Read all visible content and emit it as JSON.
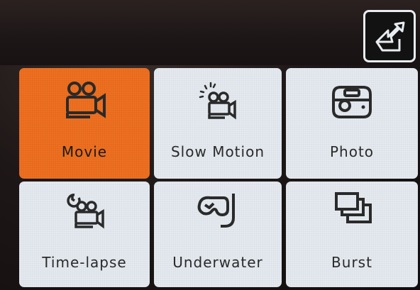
{
  "screen_title": "",
  "back_button": {
    "icon": "return-arrow-icon"
  },
  "modes": [
    {
      "label": "Movie",
      "icon": "movie-camera-icon",
      "selected": true
    },
    {
      "label": "Slow Motion",
      "icon": "slow-motion-camera-icon",
      "selected": false
    },
    {
      "label": "Photo",
      "icon": "photo-camera-icon",
      "selected": false
    },
    {
      "label": "Time-lapse",
      "icon": "time-lapse-camera-icon",
      "selected": false
    },
    {
      "label": "Underwater",
      "icon": "diving-mask-icon",
      "selected": false
    },
    {
      "label": "Burst",
      "icon": "burst-frames-icon",
      "selected": false
    }
  ],
  "colors": {
    "selected_tile": "#f07020",
    "tile": "#e4eaf0",
    "icon_stroke": "#2a2a2a",
    "background": "#1a1414"
  }
}
